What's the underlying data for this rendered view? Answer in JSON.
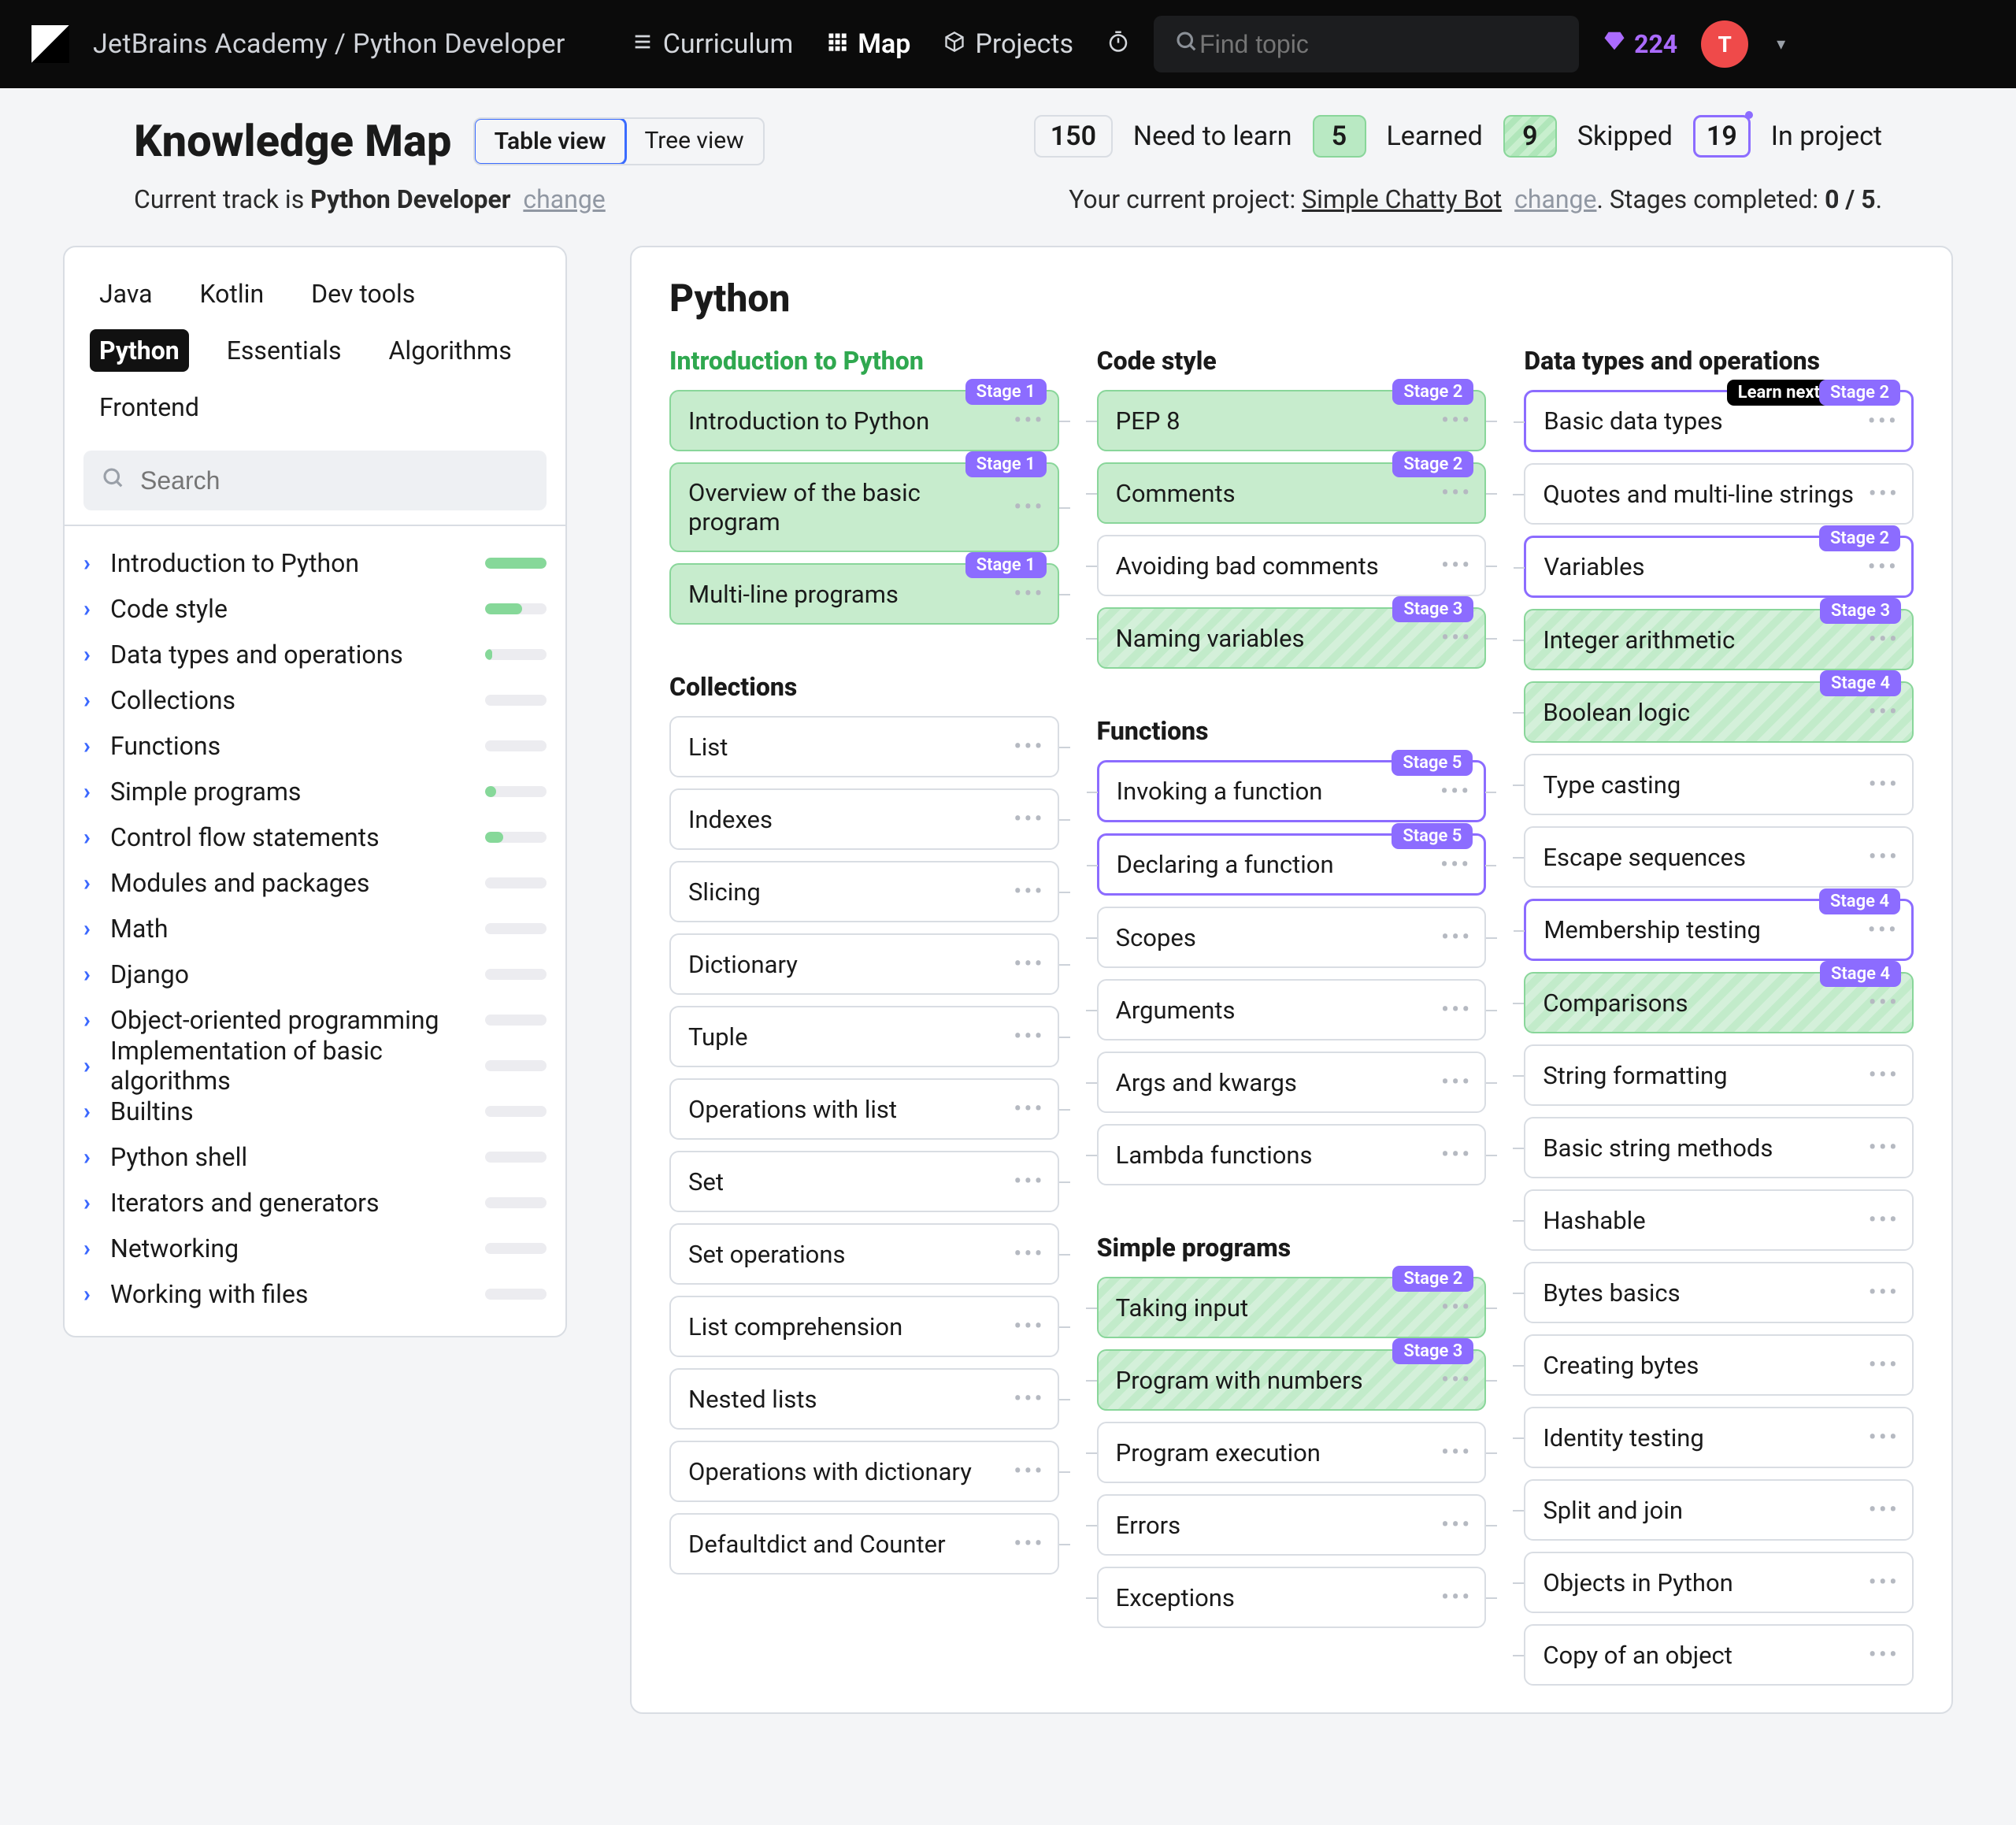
{
  "header": {
    "breadcrumb": "JetBrains Academy / Python Developer",
    "nav": {
      "curriculum": "Curriculum",
      "map": "Map",
      "projects": "Projects"
    },
    "search_placeholder": "Find topic",
    "gems": "224",
    "avatar_initial": "T"
  },
  "title": {
    "heading": "Knowledge Map",
    "view": {
      "table": "Table view",
      "tree": "Tree view"
    },
    "stats": {
      "need_count": "150",
      "need_label": "Need to learn",
      "learned_count": "5",
      "learned_label": "Learned",
      "skipped_count": "9",
      "skipped_label": "Skipped",
      "project_count": "19",
      "project_label": "In project"
    },
    "track_pre": "Current track is ",
    "track_name": "Python Developer",
    "change": "change",
    "proj_pre": "Your current project: ",
    "proj_name": "Simple Chatty Bot",
    "stages_label": ". Stages completed: ",
    "stages_value": "0 / 5",
    "dot": "."
  },
  "labels": {
    "stage_prefix": "Stage ",
    "learn_next": "Learn next"
  },
  "sidebar": {
    "tabs": [
      "Java",
      "Kotlin",
      "Dev tools",
      "Python",
      "Essentials",
      "Algorithms",
      "Frontend"
    ],
    "active_tab": "Python",
    "search_placeholder": "Search",
    "tree": [
      {
        "label": "Introduction to Python",
        "pct": 100
      },
      {
        "label": "Code style",
        "pct": 60
      },
      {
        "label": "Data types and operations",
        "pct": 12
      },
      {
        "label": "Collections",
        "pct": 0
      },
      {
        "label": "Functions",
        "pct": 0
      },
      {
        "label": "Simple programs",
        "pct": 18
      },
      {
        "label": "Control flow statements",
        "pct": 30
      },
      {
        "label": "Modules and packages",
        "pct": 0
      },
      {
        "label": "Math",
        "pct": 0
      },
      {
        "label": "Django",
        "pct": 0
      },
      {
        "label": "Object-oriented programming",
        "pct": 0
      },
      {
        "label": "Implementation of basic algorithms",
        "pct": 0
      },
      {
        "label": "Builtins",
        "pct": 0
      },
      {
        "label": "Python shell",
        "pct": 0
      },
      {
        "label": "Iterators and generators",
        "pct": 0
      },
      {
        "label": "Networking",
        "pct": 0
      },
      {
        "label": "Working with files",
        "pct": 0
      }
    ]
  },
  "main": {
    "heading": "Python",
    "columns": [
      {
        "title": "Introduction to Python",
        "title_green": true,
        "cards": [
          {
            "label": "Introduction to Python",
            "state": "learned",
            "stage": "1"
          },
          {
            "label": "Overview of the basic program",
            "state": "learned",
            "stage": "1"
          },
          {
            "label": "Multi-line programs",
            "state": "learned",
            "stage": "1"
          }
        ],
        "extra_title": "Collections",
        "extra_cards": [
          {
            "label": "List"
          },
          {
            "label": "Indexes"
          },
          {
            "label": "Slicing"
          },
          {
            "label": "Dictionary"
          },
          {
            "label": "Tuple"
          },
          {
            "label": "Operations with list"
          },
          {
            "label": "Set"
          },
          {
            "label": "Set operations"
          },
          {
            "label": "List comprehension"
          },
          {
            "label": "Nested lists"
          },
          {
            "label": "Operations with dictionary"
          },
          {
            "label": "Defaultdict and Counter"
          }
        ]
      },
      {
        "title": "Code style",
        "cards": [
          {
            "label": "PEP 8",
            "state": "learned",
            "stage": "2"
          },
          {
            "label": "Comments",
            "state": "learned",
            "stage": "2"
          },
          {
            "label": "Avoiding bad comments"
          },
          {
            "label": "Naming variables",
            "state": "skip",
            "stage": "3"
          }
        ],
        "extra_title": "Functions",
        "extra_cards": [
          {
            "label": "Invoking a function",
            "state": "current",
            "stage": "5"
          },
          {
            "label": "Declaring a function",
            "state": "current",
            "stage": "5"
          },
          {
            "label": "Scopes"
          },
          {
            "label": "Arguments"
          },
          {
            "label": "Args and kwargs"
          },
          {
            "label": "Lambda functions"
          }
        ],
        "extra2_title": "Simple programs",
        "extra2_cards": [
          {
            "label": "Taking input",
            "state": "skip",
            "stage": "2"
          },
          {
            "label": "Program with numbers",
            "state": "skip",
            "stage": "3"
          },
          {
            "label": "Program execution"
          },
          {
            "label": "Errors"
          },
          {
            "label": "Exceptions"
          }
        ]
      },
      {
        "title": "Data types and operations",
        "cards": [
          {
            "label": "Basic data types",
            "state": "current",
            "stage": "2",
            "learn_next": true
          },
          {
            "label": "Quotes and multi-line strings"
          },
          {
            "label": "Variables",
            "state": "current",
            "stage": "2"
          },
          {
            "label": "Integer arithmetic",
            "state": "skip",
            "stage": "3"
          },
          {
            "label": "Boolean logic",
            "state": "skip",
            "stage": "4"
          },
          {
            "label": "Type casting"
          },
          {
            "label": "Escape sequences"
          },
          {
            "label": "Membership testing",
            "state": "current",
            "stage": "4"
          },
          {
            "label": "Comparisons",
            "state": "skip",
            "stage": "4"
          },
          {
            "label": "String formatting"
          },
          {
            "label": "Basic string methods"
          },
          {
            "label": "Hashable"
          },
          {
            "label": "Bytes basics"
          },
          {
            "label": "Creating bytes"
          },
          {
            "label": "Identity testing"
          },
          {
            "label": "Split and join"
          },
          {
            "label": "Objects in Python"
          },
          {
            "label": "Copy of an object"
          }
        ]
      }
    ]
  }
}
